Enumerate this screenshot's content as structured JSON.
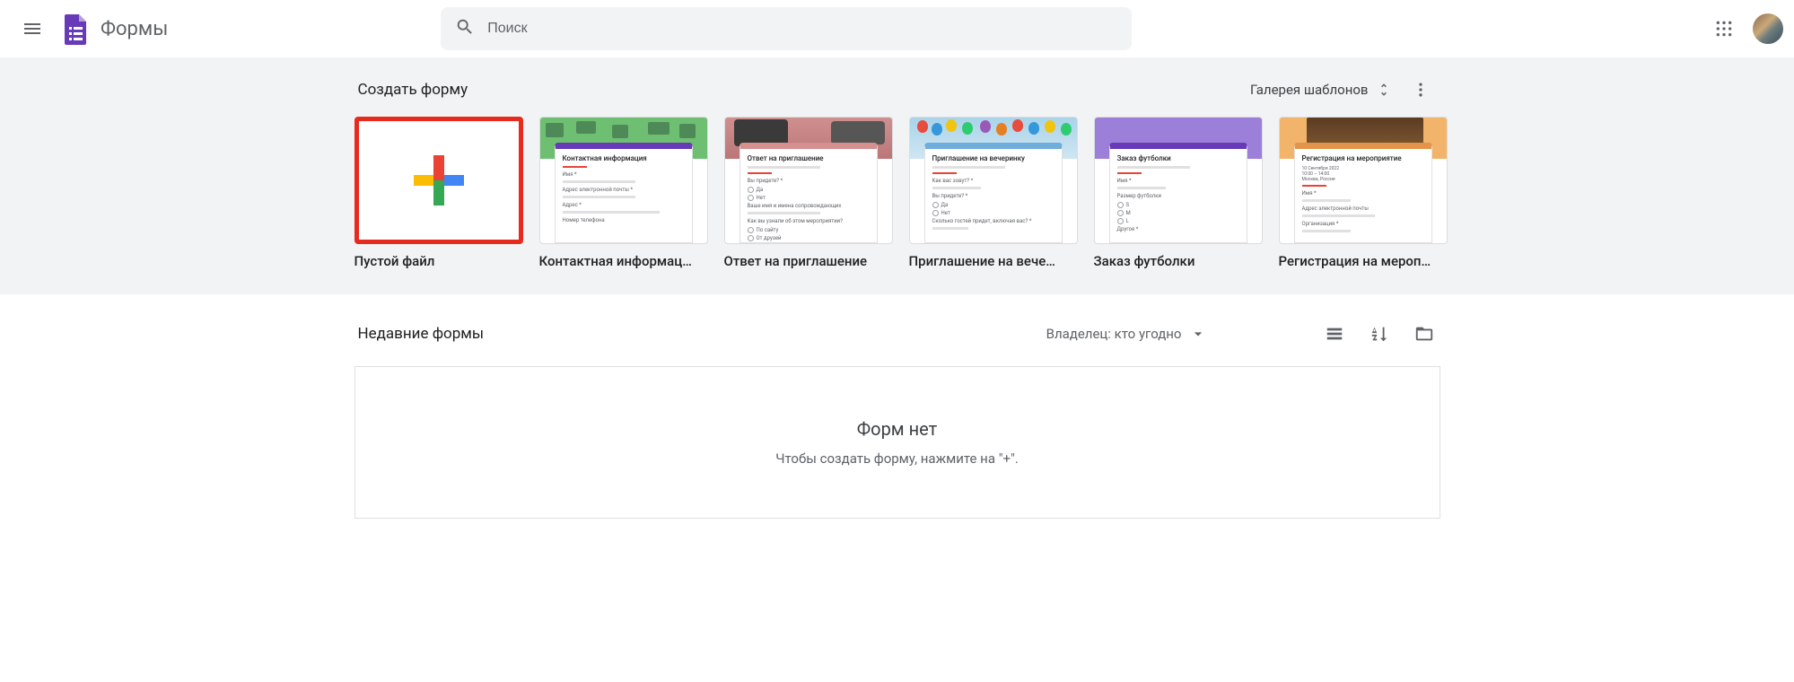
{
  "header": {
    "app_name": "Формы",
    "search_placeholder": "Поиск"
  },
  "templates": {
    "section_title": "Создать форму",
    "gallery_button": "Галерея шаблонов",
    "items": [
      {
        "label": "Пустой файл"
      },
      {
        "label": "Контактная информац…",
        "form_title": "Контактная информация"
      },
      {
        "label": "Ответ на приглашение",
        "form_title": "Ответ на приглашение"
      },
      {
        "label": "Приглашение на вече…",
        "form_title": "Приглашение на вечеринку"
      },
      {
        "label": "Заказ футболки",
        "form_title": "Заказ футболки"
      },
      {
        "label": "Регистрация на мероп…",
        "form_title": "Регистрация на мероприятие"
      }
    ]
  },
  "recent": {
    "section_title": "Недавние формы",
    "owner_filter": "Владелец: кто угодно",
    "empty_title": "Форм нет",
    "empty_subtitle": "Чтобы создать форму, нажмите на \"+\"."
  }
}
